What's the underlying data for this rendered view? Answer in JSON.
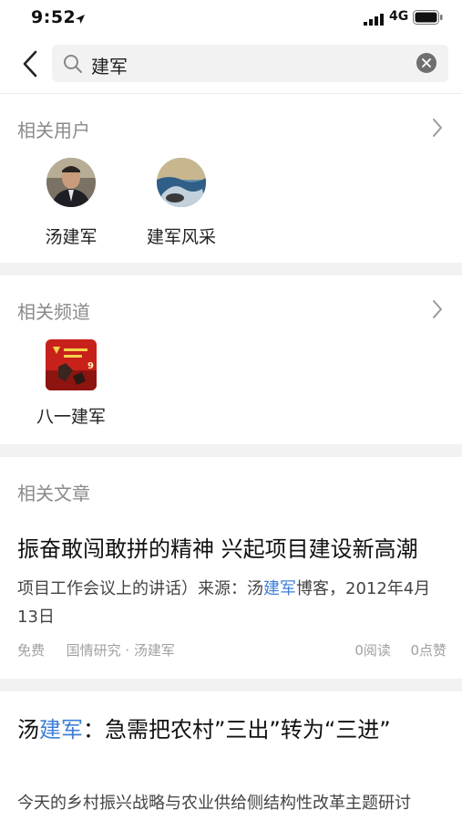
{
  "status_bar": {
    "time": "9:52",
    "network": "4G"
  },
  "search": {
    "query": "建军"
  },
  "related_users": {
    "title": "相关用户",
    "users": [
      {
        "name": "汤建军"
      },
      {
        "name": "建军风采"
      }
    ]
  },
  "related_channels": {
    "title": "相关频道",
    "channels": [
      {
        "name": "八一建军"
      }
    ]
  },
  "related_articles": {
    "title": "相关文章",
    "articles": [
      {
        "title": "振奋敢闯敢拼的精神 兴起项目建设新高潮",
        "excerpt_before": "项目工作会议上的讲话）来源：汤",
        "excerpt_highlight": "建军",
        "excerpt_after": "博客，2012年4月13日",
        "price": "免费",
        "category_author": "国情研究 · 汤建军",
        "reads": "0阅读",
        "likes": "0点赞"
      },
      {
        "title_before": "汤",
        "title_highlight": "建军",
        "title_after": "：急需把农村”三出”转为“三进”",
        "excerpt": "今天的乡村振兴战略与农业供给侧结构性改革主题研讨"
      }
    ]
  },
  "colors": {
    "highlight": "#3f7fd6",
    "section_title": "#8a8a8a",
    "page_bg": "#f2f2f3"
  }
}
